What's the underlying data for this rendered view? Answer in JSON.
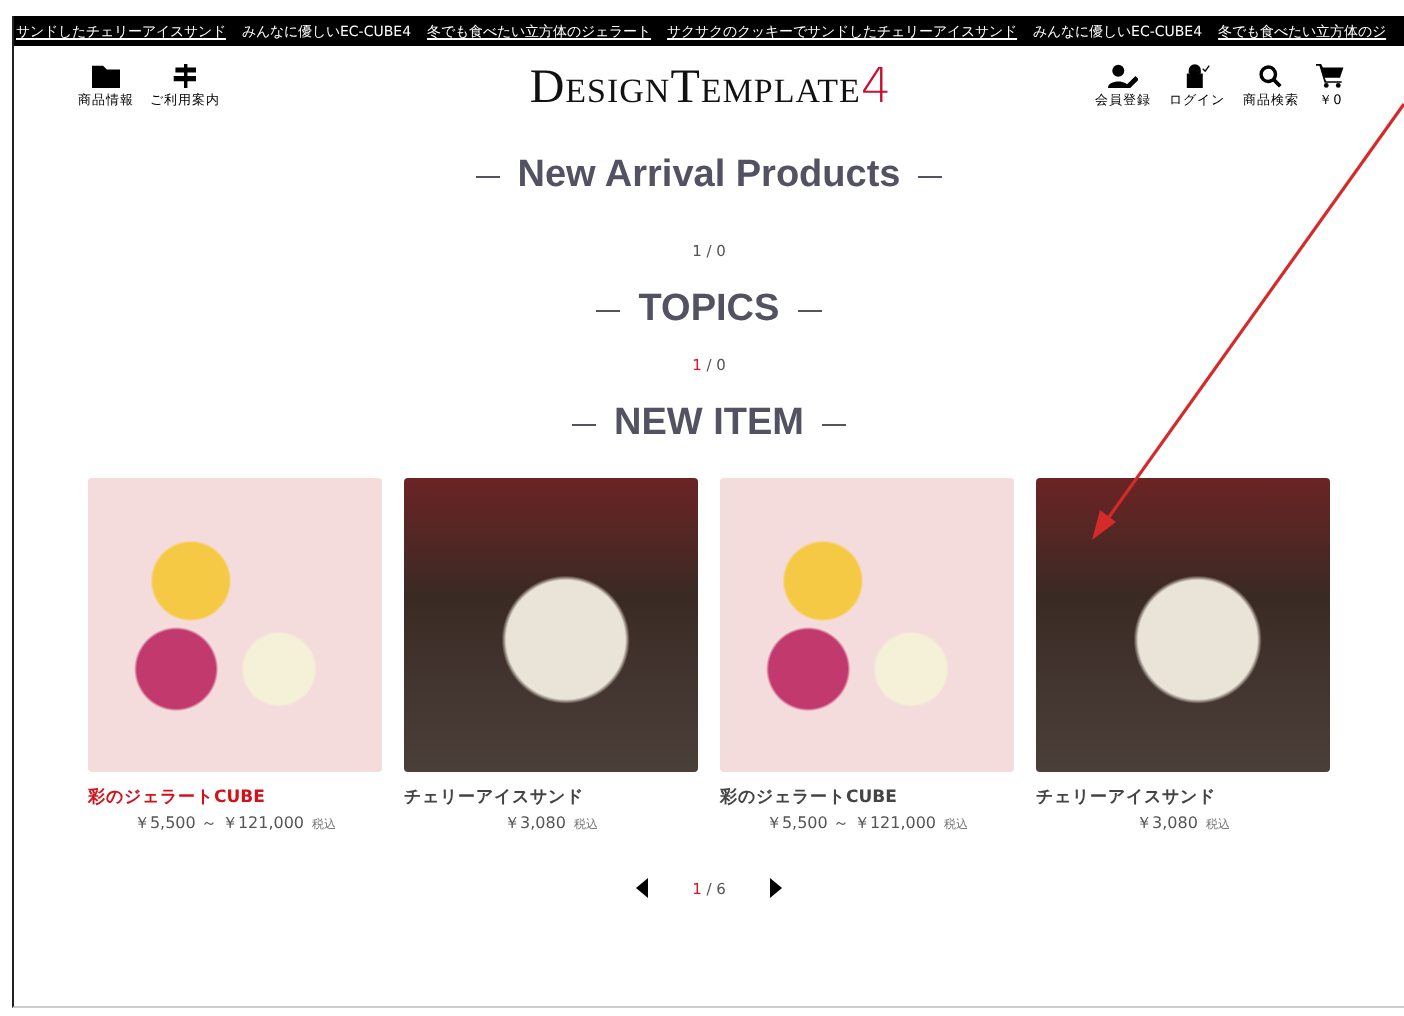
{
  "ticker": [
    {
      "text": "サンドしたチェリーアイスサンド",
      "link": true
    },
    {
      "text": "みんなに優しいEC-CUBE4",
      "link": false
    },
    {
      "text": "冬でも食べたい立方体のジェラート",
      "link": true
    },
    {
      "text": "サクサクのクッキーでサンドしたチェリーアイスサンド",
      "link": true
    },
    {
      "text": "みんなに優しいEC-CUBE4",
      "link": false
    },
    {
      "text": "冬でも食べたい立方体のジ",
      "link": true
    }
  ],
  "header": {
    "left_nav": [
      {
        "label": "商品情報",
        "kind": "folder"
      },
      {
        "label": "ご利用案内",
        "kind": "signpost"
      }
    ],
    "logo": {
      "text": "DesignTemplate",
      "accent": "4"
    },
    "right_nav": [
      {
        "label": "会員登録",
        "kind": "user"
      },
      {
        "label": "ログイン",
        "kind": "lock"
      },
      {
        "label": "商品検索",
        "kind": "search"
      },
      {
        "label": "￥0",
        "kind": "cart"
      }
    ]
  },
  "sections": [
    {
      "title": "New Arrival Products",
      "pager": {
        "current": "1",
        "separator": "/",
        "total": "0",
        "highlighted": false
      }
    },
    {
      "title": "TOPICS",
      "pager": {
        "current": "1",
        "separator": "/",
        "total": "0",
        "highlighted": true
      }
    },
    {
      "title": "NEW ITEM",
      "pager": {
        "current": "1",
        "separator": "/",
        "total": "6",
        "highlighted": true,
        "arrows": true
      },
      "products": [
        {
          "name": "彩のジェラートCUBE",
          "price": "￥5,500 ～ ￥121,000",
          "tax": "税込",
          "kind": "gelato",
          "highlighted": true
        },
        {
          "name": "チェリーアイスサンド",
          "price": "￥3,080",
          "tax": "税込",
          "kind": "cherry",
          "highlighted": false
        },
        {
          "name": "彩のジェラートCUBE",
          "price": "￥5,500 ～ ￥121,000",
          "tax": "税込",
          "kind": "gelato",
          "highlighted": false
        },
        {
          "name": "チェリーアイスサンド",
          "price": "￥3,080",
          "tax": "税込",
          "kind": "cherry",
          "highlighted": false
        }
      ]
    }
  ]
}
